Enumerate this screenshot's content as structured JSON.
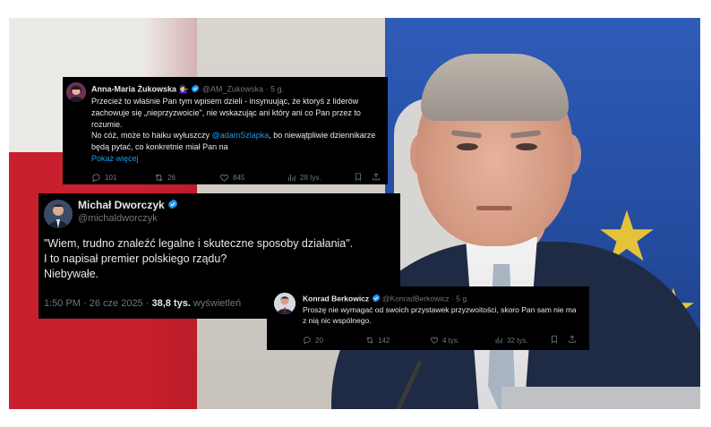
{
  "colors": {
    "card_bg": "#000000",
    "text": "#e7e9ea",
    "muted": "#71767b",
    "link": "#1d9bf0",
    "verified": "#1d9bf0"
  },
  "tweet1": {
    "name": "Anna-Maria Żukowska",
    "emoji": "💁🏻‍♀️",
    "handle": "@AM_Zukowska · 5 g.",
    "text_p1": "Przecież to właśnie Pan tym wpisem dzieli - insynuując, że ktoryś z liderów zachowuje się „nieprzyzwoicie\", nie wskazując ani który ani co Pan przez to rozumie.",
    "text_p2_before": "No cóż, może to haiku wyłuszczy ",
    "text_p2_mention": "@adamSzlapka",
    "text_p2_after": ", bo niewątpliwie dziennikarze będą pytać, co konkretnie miał Pan na",
    "show_more": "Pokaż więcej",
    "replies": "101",
    "reposts": "26",
    "likes": "845",
    "views": "28 tys."
  },
  "tweet2": {
    "name": "Michał Dworczyk",
    "handle": "@michaldworczyk",
    "line1": "\"Wiem, trudno znaleźć legalne i skuteczne sposoby działania\".",
    "line2": "I to napisał premier polskiego rządu?",
    "line3": "Niebywałe.",
    "time": "1:50 PM · 26 cze 2025 · ",
    "views_count": "38,8 tys.",
    "views_label": " wyświetleń"
  },
  "tweet3": {
    "name": "Konrad Berkowicz",
    "handle": "@KonradBerkowicz · 5 g.",
    "text": "Proszę nie wymagać od swoich przystawek przyzwoitości, skoro Pan sam nie ma z nią nic wspólnego.",
    "replies": "20",
    "reposts": "142",
    "likes": "4 tys.",
    "views": "32 tys."
  },
  "icons": [
    "verified-badge-icon",
    "reply-icon",
    "repost-icon",
    "like-icon",
    "views-icon",
    "bookmark-icon",
    "share-icon"
  ]
}
